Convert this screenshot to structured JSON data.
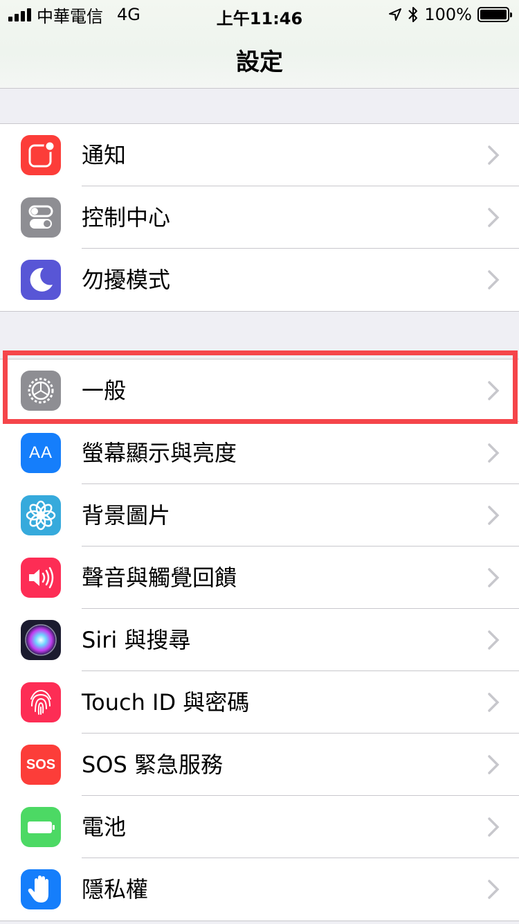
{
  "status_bar": {
    "carrier": "中華電信",
    "network": "4G",
    "time": "上午11:46",
    "battery": "100%",
    "battery_level": 1.0
  },
  "nav": {
    "title": "設定"
  },
  "groups": [
    {
      "items": [
        {
          "label": "通知",
          "icon": "notifications-icon",
          "color": "#fc3d39"
        },
        {
          "label": "控制中心",
          "icon": "control-center-icon",
          "color": "#8e8e93"
        },
        {
          "label": "勿擾模式",
          "icon": "moon-icon",
          "color": "#5856d6"
        }
      ]
    },
    {
      "items": [
        {
          "label": "一般",
          "icon": "gear-icon",
          "color": "#8e8e93"
        },
        {
          "label": "螢幕顯示與亮度",
          "icon": "display-aa-icon",
          "color": "#157efb",
          "icon_text": "AA"
        },
        {
          "label": "背景圖片",
          "icon": "flower-icon",
          "color": "#36aadc"
        },
        {
          "label": "聲音與觸覺回饋",
          "icon": "speaker-icon",
          "color": "#fd2d55"
        },
        {
          "label": "Siri 與搜尋",
          "icon": "siri-icon",
          "color": "#1b1b2f"
        },
        {
          "label": "Touch ID 與密碼",
          "icon": "fingerprint-icon",
          "color": "#fd2d55"
        },
        {
          "label": "SOS 緊急服務",
          "icon": "sos-icon",
          "color": "#fc3d39",
          "icon_text": "SOS"
        },
        {
          "label": "電池",
          "icon": "battery-icon",
          "color": "#4cd964"
        },
        {
          "label": "隱私權",
          "icon": "hand-icon",
          "color": "#157efb"
        }
      ]
    }
  ]
}
